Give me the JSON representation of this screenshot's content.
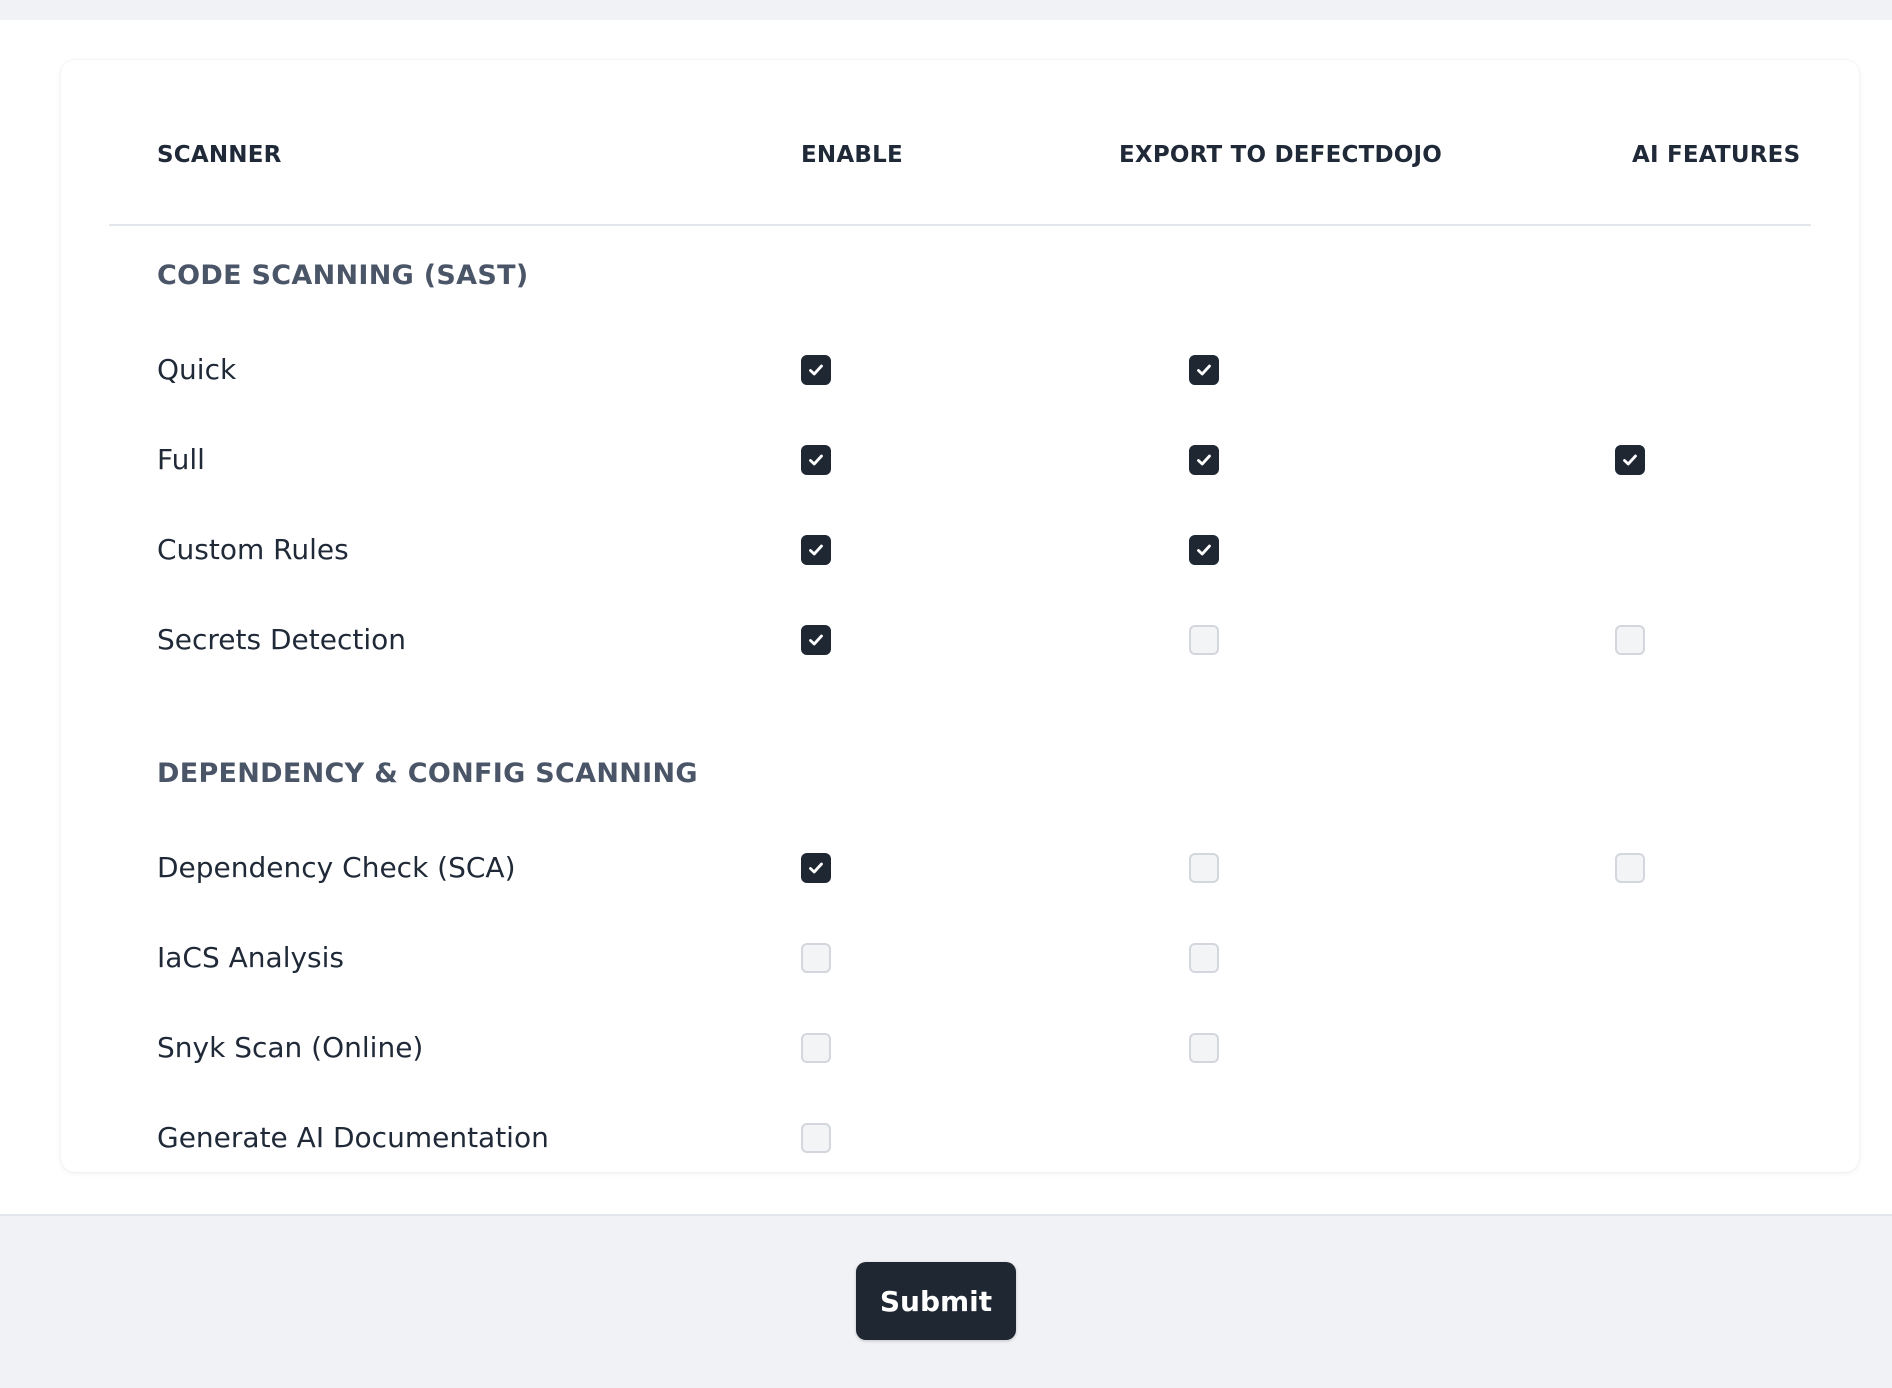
{
  "columns": {
    "scanner": "SCANNER",
    "enable": "ENABLE",
    "export": "EXPORT TO DEFECTDOJO",
    "ai": "AI FEATURES"
  },
  "sections": [
    {
      "title": "CODE SCANNING (SAST)",
      "rows": [
        {
          "label": "Quick",
          "enable": true,
          "export": true,
          "ai": null
        },
        {
          "label": "Full",
          "enable": true,
          "export": true,
          "ai": true
        },
        {
          "label": "Custom Rules",
          "enable": true,
          "export": true,
          "ai": null
        },
        {
          "label": "Secrets Detection",
          "enable": true,
          "export": false,
          "ai": false
        }
      ]
    },
    {
      "title": "DEPENDENCY & CONFIG SCANNING",
      "rows": [
        {
          "label": "Dependency Check (SCA)",
          "enable": true,
          "export": false,
          "ai": false
        },
        {
          "label": "IaCS Analysis",
          "enable": false,
          "export": false,
          "ai": null
        },
        {
          "label": "Snyk Scan (Online)",
          "enable": false,
          "export": false,
          "ai": null
        },
        {
          "label": "Generate AI Documentation",
          "enable": false,
          "export": null,
          "ai": null
        }
      ]
    }
  ],
  "submit_label": "Submit",
  "colors": {
    "checked": "#1f2733",
    "unchecked_bg": "#f3f4f6",
    "unchecked_border": "#d3d7dd",
    "section_title": "#4b5568"
  }
}
